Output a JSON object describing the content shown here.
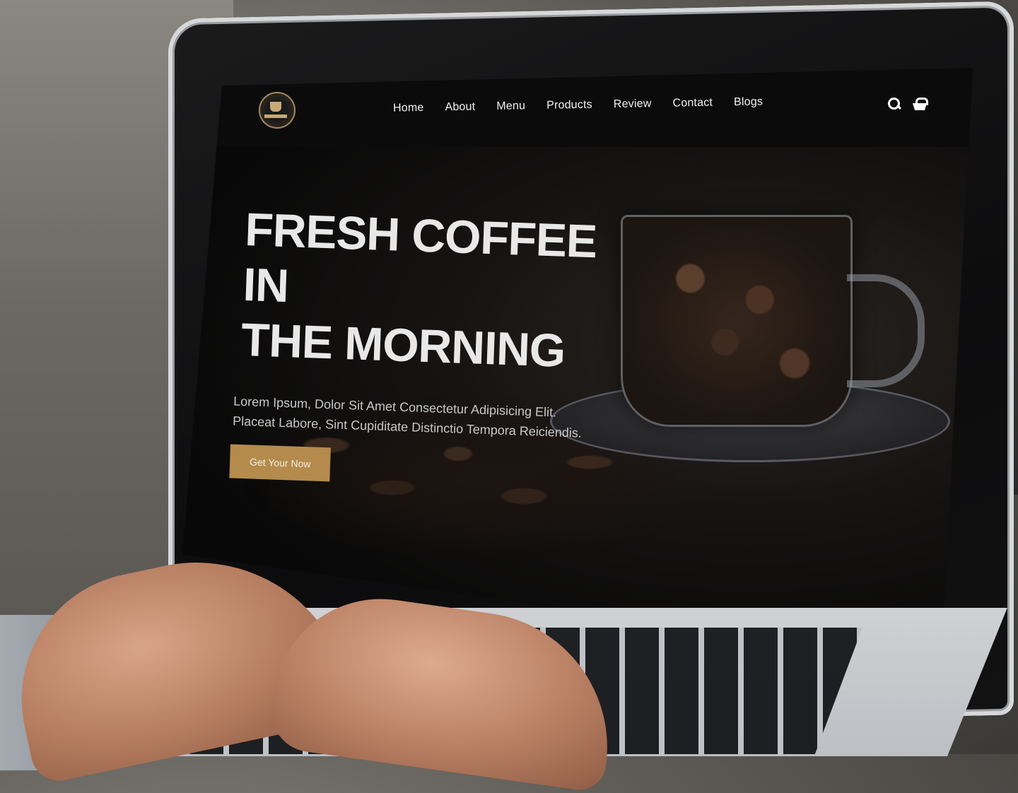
{
  "nav": {
    "links": [
      "Home",
      "About",
      "Menu",
      "Products",
      "Review",
      "Contact",
      "Blogs"
    ]
  },
  "hero": {
    "title_line1": "FRESH COFFEE IN",
    "title_line2": "THE MORNING",
    "subtitle": "Lorem Ipsum, Dolor Sit Amet Consectetur Adipisicing Elit. Placeat Labore, Sint Cupiditate Distinctio Tempora Reiciendis.",
    "cta_label": "Get Your Now"
  },
  "icons": {
    "search": "search-icon",
    "basket": "basket-icon",
    "logo": "coffee-logo"
  },
  "colors": {
    "accent": "#b48b4c",
    "text": "#e8e8e8",
    "background": "#0a0a0b"
  }
}
